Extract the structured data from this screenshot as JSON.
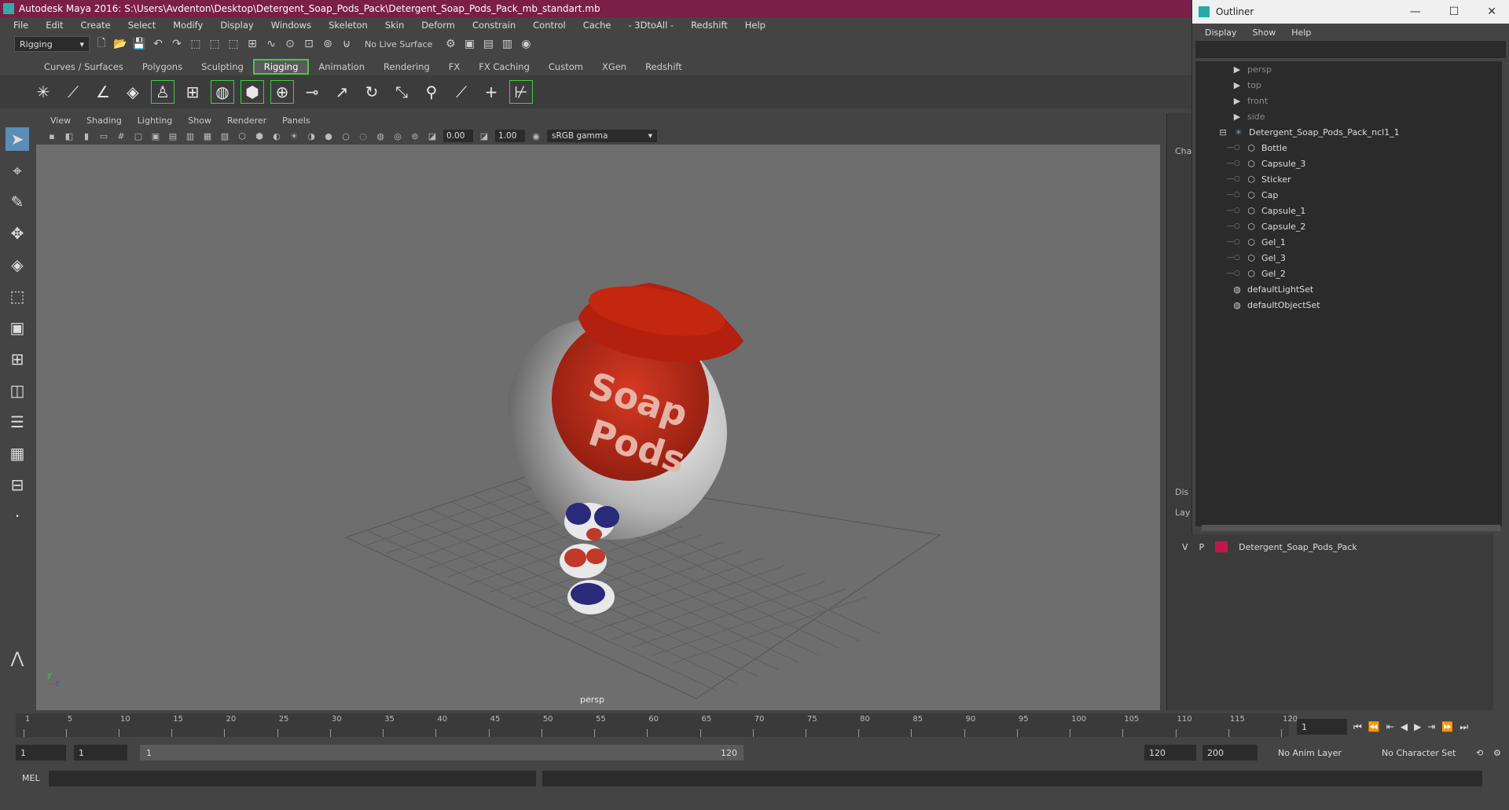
{
  "window": {
    "title": "Autodesk Maya 2016: S:\\Users\\Avdenton\\Desktop\\Detergent_Soap_Pods_Pack\\Detergent_Soap_Pods_Pack_mb_standart.mb"
  },
  "menubar": [
    "File",
    "Edit",
    "Create",
    "Select",
    "Modify",
    "Display",
    "Windows",
    "Skeleton",
    "Skin",
    "Deform",
    "Constrain",
    "Control",
    "Cache",
    "- 3DtoAll -",
    "Redshift",
    "Help"
  ],
  "statusline": {
    "menuset": "Rigging",
    "live_surface": "No Live Surface"
  },
  "shelf": {
    "tabs": [
      "Curves / Surfaces",
      "Polygons",
      "Sculpting",
      "Rigging",
      "Animation",
      "Rendering",
      "FX",
      "FX Caching",
      "Custom",
      "XGen",
      "Redshift"
    ],
    "active_tab": "Rigging"
  },
  "panel": {
    "menu": [
      "View",
      "Shading",
      "Lighting",
      "Show",
      "Renderer",
      "Panels"
    ],
    "near_value": "0.00",
    "far_value": "1.00",
    "color_space": "sRGB gamma",
    "camera_label": "persp"
  },
  "model": {
    "label_line1": "Soap",
    "label_line2": "Pods"
  },
  "channel_box": {
    "tab1": "Cha",
    "tab2": "Dis",
    "tab3": "Lay"
  },
  "outliner": {
    "title": "Outliner",
    "menu": [
      "Display",
      "Show",
      "Help"
    ],
    "cameras": [
      "persp",
      "top",
      "front",
      "side"
    ],
    "group": "Detergent_Soap_Pods_Pack_ncl1_1",
    "children": [
      "Bottle",
      "Capsule_3",
      "Sticker",
      "Cap",
      "Capsule_1",
      "Capsule_2",
      "Gel_1",
      "Gel_3",
      "Gel_2"
    ],
    "sets": [
      "defaultLightSet",
      "defaultObjectSet"
    ]
  },
  "layers": {
    "v": "V",
    "p": "P",
    "name": "Detergent_Soap_Pods_Pack",
    "color": "#c0184a"
  },
  "timeline": {
    "ticks": [
      1,
      5,
      10,
      15,
      20,
      25,
      30,
      35,
      40,
      45,
      50,
      55,
      60,
      65,
      70,
      75,
      80,
      85,
      90,
      95,
      100,
      105,
      110,
      115,
      120
    ],
    "current_frame": "1"
  },
  "range": {
    "start": "1",
    "playback_start": "1",
    "bar_start": "1",
    "bar_end": "120",
    "playback_end": "120",
    "end": "200",
    "anim_layer": "No Anim Layer",
    "character_set": "No Character Set"
  },
  "cmdline": {
    "label": "MEL"
  }
}
